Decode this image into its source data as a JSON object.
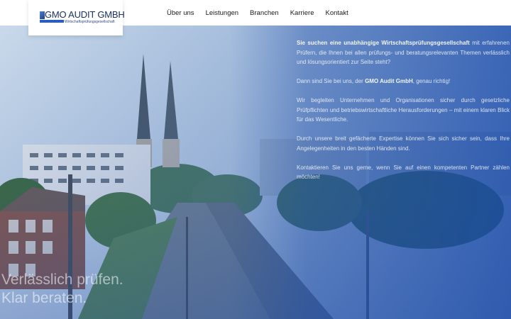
{
  "brand": {
    "name": "GMO AUDIT GMBH",
    "subtitle": "Wirtschaftsprüfungsgesellschaft"
  },
  "nav": {
    "items": [
      {
        "label": "Über uns"
      },
      {
        "label": "Leistungen"
      },
      {
        "label": "Branchen"
      },
      {
        "label": "Karriere"
      },
      {
        "label": "Kontakt"
      }
    ]
  },
  "hero": {
    "intro_bold": "Sie suchen eine unabhängige Wirtschaftsprüfungsgesellschaft",
    "intro_rest": " mit erfahrenen Prüfern, die Ihnen bei allen prüfungs- und beratungsrelevanten Themen verlässlich und lösungsorientiert zur Seite steht?",
    "p2_start": "Dann sind Sie bei uns, der ",
    "p2_bold": "GMO Audit GmbH",
    "p2_end": ", genau richtig!",
    "p3": "Wir begleiten Unternehmen und Organisationen sicher durch gesetzliche Prüfpflichten und betriebswirtschaftliche Herausforderungen – mit einem klaren Blick für das Wesentliche.",
    "p4": "Durch unsere breit gefächerte Expertise können Sie sich sicher sein, dass Ihre Angelegenheiten in den besten Händen sind.",
    "p5": "Kontaktieren Sie uns gerne, wenn Sie auf einen kompetenten Partner zählen möchten!",
    "tagline_1": "Verlässlich prüfen.",
    "tagline_2": "Klar beraten."
  },
  "colors": {
    "brand_blue": "#1b2f66",
    "overlay_blue": "#1e50aa"
  }
}
